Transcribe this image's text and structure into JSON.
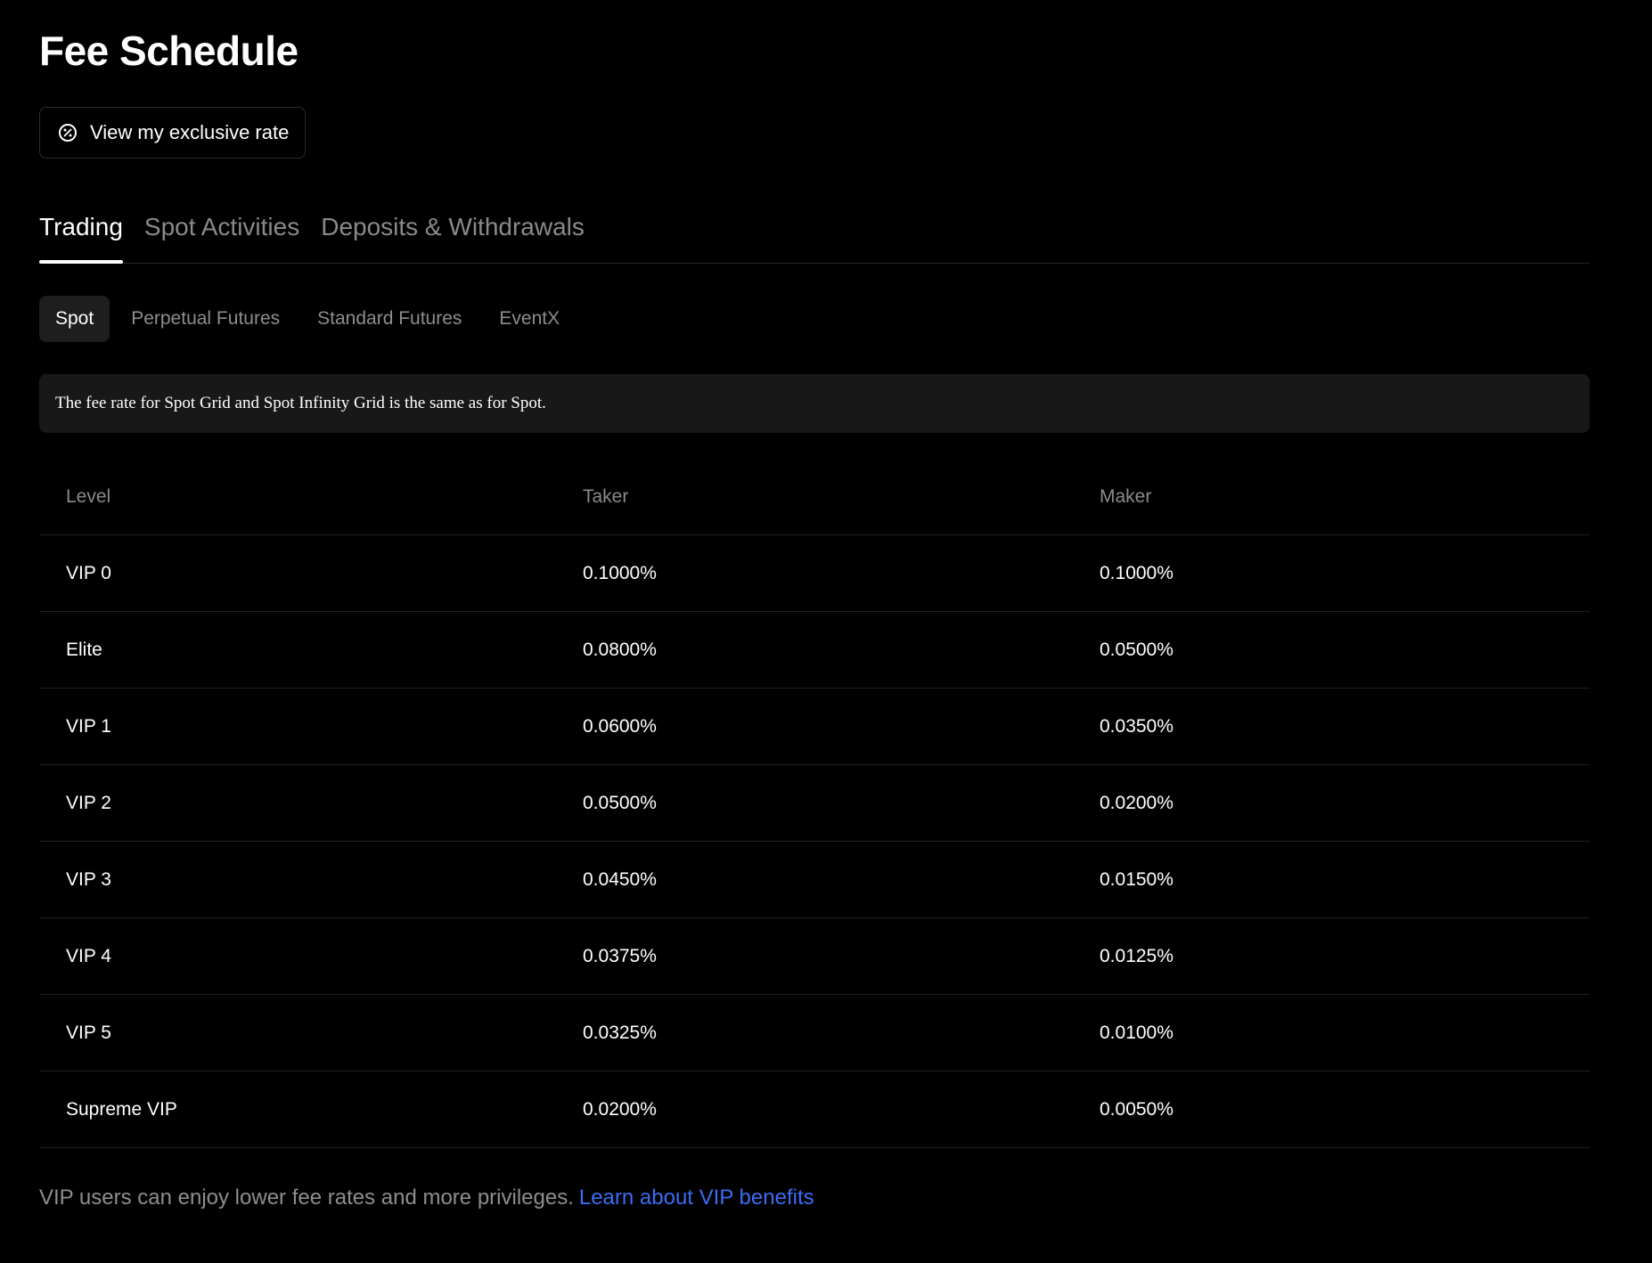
{
  "page_title": "Fee Schedule",
  "rate_button": {
    "icon": "discount-icon",
    "label": "View my exclusive rate"
  },
  "main_tabs": [
    {
      "label": "Trading",
      "active": true
    },
    {
      "label": "Spot Activities",
      "active": false
    },
    {
      "label": "Deposits & Withdrawals",
      "active": false
    }
  ],
  "sub_tabs": [
    {
      "label": "Spot",
      "active": true
    },
    {
      "label": "Perpetual Futures",
      "active": false
    },
    {
      "label": "Standard Futures",
      "active": false
    },
    {
      "label": "EventX",
      "active": false
    }
  ],
  "notice": "The fee rate for Spot Grid and Spot Infinity Grid is the same as for Spot.",
  "table": {
    "headers": [
      "Level",
      "Taker",
      "Maker"
    ],
    "rows": [
      [
        "VIP 0",
        "0.1000%",
        "0.1000%"
      ],
      [
        "Elite",
        "0.0800%",
        "0.0500%"
      ],
      [
        "VIP 1",
        "0.0600%",
        "0.0350%"
      ],
      [
        "VIP 2",
        "0.0500%",
        "0.0200%"
      ],
      [
        "VIP 3",
        "0.0450%",
        "0.0150%"
      ],
      [
        "VIP 4",
        "0.0375%",
        "0.0125%"
      ],
      [
        "VIP 5",
        "0.0325%",
        "0.0100%"
      ],
      [
        "Supreme VIP",
        "0.0200%",
        "0.0050%"
      ]
    ]
  },
  "footer": {
    "text": "VIP users can enjoy lower fee rates and more privileges.",
    "link": "Learn about VIP benefits"
  },
  "colors": {
    "background": "#000000",
    "link": "#3a6cf4",
    "muted_text": "#8a8a8a",
    "notice_bg": "#181818"
  }
}
